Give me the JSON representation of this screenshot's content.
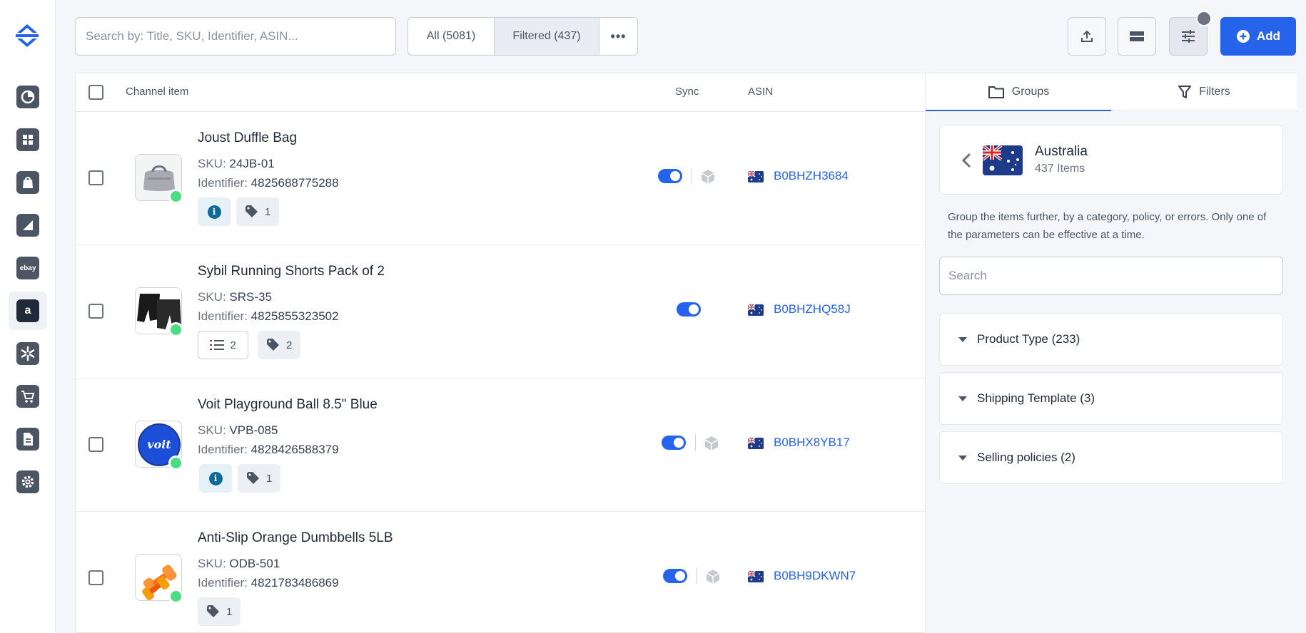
{
  "search": {
    "placeholder": "Search by: Title, SKU, Identifier, ASIN..."
  },
  "filters": {
    "all": "All (5081)",
    "filtered": "Filtered (437)",
    "more": "•••"
  },
  "add_button": {
    "label": "Add"
  },
  "sidebar": {
    "items": [
      {
        "name": "dashboard-icon"
      },
      {
        "name": "inventory-icon"
      },
      {
        "name": "shopify-icon"
      },
      {
        "name": "bigcommerce-icon"
      },
      {
        "name": "ebay-icon",
        "text": "ebay"
      },
      {
        "name": "amazon-icon",
        "text": "a"
      },
      {
        "name": "walmart-icon"
      },
      {
        "name": "cart-icon"
      },
      {
        "name": "document-icon"
      },
      {
        "name": "settings-icon"
      }
    ]
  },
  "table": {
    "headers": {
      "item": "Channel item",
      "sync": "Sync",
      "asin": "ASIN"
    },
    "rows": [
      {
        "title": "Joust Duffle Bag",
        "sku_label": "SKU:",
        "sku": "24JB-01",
        "id_label": "Identifier:",
        "identifier": "4825688775288",
        "tag_count": "1",
        "list_count": "",
        "asin": "B0BHZH3684"
      },
      {
        "title": "Sybil Running Shorts Pack of 2",
        "sku_label": "SKU:",
        "sku": "SRS-35",
        "id_label": "Identifier:",
        "identifier": "4825855323502",
        "tag_count": "2",
        "list_count": "2",
        "asin": "B0BHZHQ58J"
      },
      {
        "title": "Voit Playground Ball 8.5\" Blue",
        "sku_label": "SKU:",
        "sku": "VPB-085",
        "id_label": "Identifier:",
        "identifier": "4828426588379",
        "tag_count": "1",
        "list_count": "",
        "asin": "B0BHX8YB17"
      },
      {
        "title": "Anti-Slip Orange Dumbbells 5LB",
        "sku_label": "SKU:",
        "sku": "ODB-501",
        "id_label": "Identifier:",
        "identifier": "4821783486869",
        "tag_count": "1",
        "list_count": "",
        "asin": "B0BH9DKWN7"
      }
    ]
  },
  "panel": {
    "tabs": {
      "groups": "Groups",
      "filters": "Filters"
    },
    "country": {
      "name": "Australia",
      "count": "437 Items"
    },
    "hint": "Group the items further, by a category, policy, or errors. Only one of the parameters can be effective at a time.",
    "search_placeholder": "Search",
    "groups": [
      {
        "label": "Product Type (233)"
      },
      {
        "label": "Shipping Template (3)"
      },
      {
        "label": "Selling policies (2)"
      }
    ]
  },
  "colors": {
    "accent": "#2563eb",
    "status_ok": "#4ade80"
  }
}
